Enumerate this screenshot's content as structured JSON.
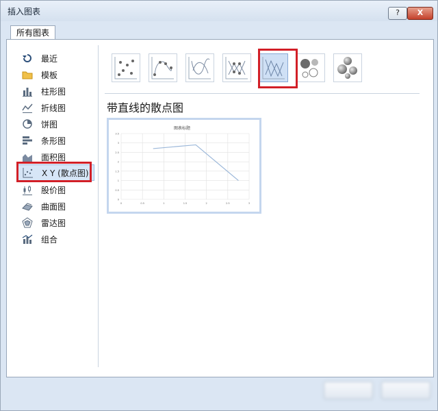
{
  "window": {
    "title": "插入图表",
    "help_label": "?",
    "close_label": "X"
  },
  "tabs": [
    {
      "label": "所有图表"
    }
  ],
  "sidebar": {
    "items": [
      {
        "label": "最近",
        "icon": "recent-icon"
      },
      {
        "label": "模板",
        "icon": "folder-icon"
      },
      {
        "label": "柱形图",
        "icon": "column-chart-icon"
      },
      {
        "label": "折线图",
        "icon": "line-chart-icon"
      },
      {
        "label": "饼图",
        "icon": "pie-chart-icon"
      },
      {
        "label": "条形图",
        "icon": "bar-chart-icon"
      },
      {
        "label": "面积图",
        "icon": "area-chart-icon"
      },
      {
        "label": "X Y (散点图)",
        "icon": "scatter-chart-icon",
        "selected": true
      },
      {
        "label": "股价图",
        "icon": "stock-chart-icon"
      },
      {
        "label": "曲面图",
        "icon": "surface-chart-icon"
      },
      {
        "label": "雷达图",
        "icon": "radar-chart-icon"
      },
      {
        "label": "组合",
        "icon": "combo-chart-icon"
      }
    ]
  },
  "chart_types": [
    {
      "icon": "scatter-icon"
    },
    {
      "icon": "scatter-smooth-lines-markers-icon"
    },
    {
      "icon": "scatter-smooth-lines-icon"
    },
    {
      "icon": "scatter-straight-lines-markers-icon"
    },
    {
      "icon": "scatter-straight-lines-icon",
      "selected": true
    },
    {
      "icon": "bubble-icon"
    },
    {
      "icon": "bubble-3d-icon"
    }
  ],
  "main": {
    "subtitle": "带直线的散点图"
  },
  "preview_chart": {
    "title": "图表标题",
    "chart_data": {
      "type": "scatter",
      "title": "图表标题",
      "x": [
        1.5,
        3.5,
        5.5
      ],
      "y": [
        2.7,
        2.9,
        1.0
      ],
      "xlim": [
        0,
        6
      ],
      "ylim": [
        0,
        3.5
      ],
      "xticks": [
        "0",
        "0.5",
        "1",
        "1.5",
        "2",
        "2.5",
        "3"
      ],
      "yticks": [
        "0",
        "0.5",
        "1",
        "1.5",
        "2",
        "2.5",
        "3",
        "3.5"
      ],
      "grid": true,
      "line_color": "#9bb7d9"
    }
  },
  "colors": {
    "accent_red": "#d21f27",
    "selection_blue": "#cfe0f5"
  }
}
